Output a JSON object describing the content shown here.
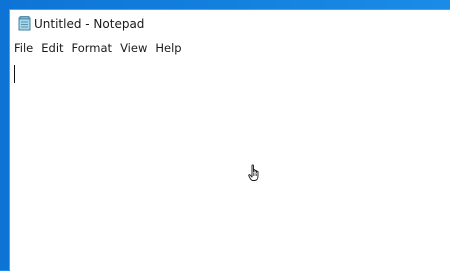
{
  "window": {
    "title": "Untitled - Notepad",
    "icon": "notepad-icon"
  },
  "menubar": {
    "items": [
      {
        "label": "File"
      },
      {
        "label": "Edit"
      },
      {
        "label": "Format"
      },
      {
        "label": "View"
      },
      {
        "label": "Help"
      }
    ]
  },
  "editor": {
    "text": ""
  },
  "pointer": {
    "icon": "hand-pointer-icon"
  },
  "colors": {
    "desktop": "#1a8ce6",
    "window_background": "#ffffff",
    "text": "#1a1a1a"
  }
}
